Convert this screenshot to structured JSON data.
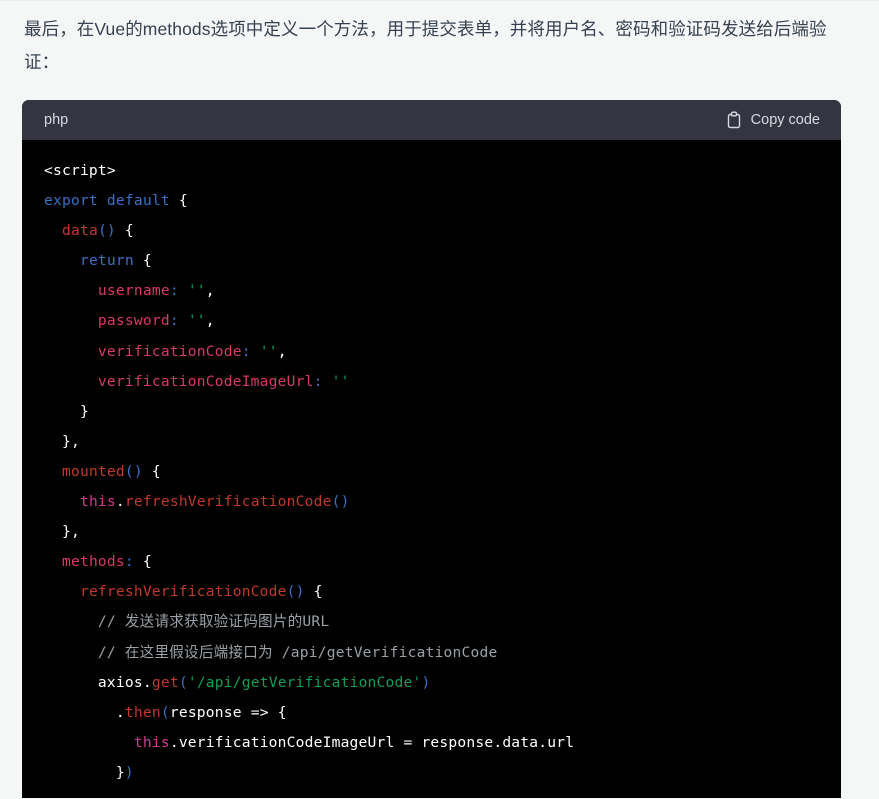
{
  "page": {
    "background_color": "#f5f6f6",
    "text_color": "#374151"
  },
  "paragraph": {
    "text": "最后，在Vue的methods选项中定义一个方法，用于提交表单，并将用户名、密码和验证码发送给后端验证："
  },
  "code_block": {
    "language_label": "php",
    "copy_label": "Copy code",
    "copy_icon": "clipboard-icon",
    "header_bg": "#343541",
    "body_bg": "#000000",
    "code_text": "<script>\nexport default {\n  data() {\n    return {\n      username: '',\n      password: '',\n      verificationCode: '',\n      verificationCodeImageUrl: ''\n    }\n  },\n  mounted() {\n    this.refreshVerificationCode()\n  },\n  methods: {\n    refreshVerificationCode() {\n      // 发送请求获取验证码图片的URL\n      // 在这里假设后端接口为 /api/getVerificationCode\n      axios.get('/api/getVerificationCode')\n        .then(response => {\n          this.verificationCodeImageUrl = response.data.url\n        })",
    "lines": [
      "<script>",
      "export default {",
      "  data() {",
      "    return {",
      "      username: '',",
      "      password: '',",
      "      verificationCode: '',",
      "      verificationCodeImageUrl: ''",
      "    }",
      "  },",
      "  mounted() {",
      "    this.refreshVerificationCode()",
      "  },",
      "  methods: {",
      "    refreshVerificationCode() {",
      "      // 发送请求获取验证码图片的URL",
      "      // 在这里假设后端接口为 /api/getVerificationCode",
      "      axios.get('/api/getVerificationCode')",
      "        .then(response => {",
      "          this.verificationCodeImageUrl = response.data.url",
      "        })"
    ],
    "token_colors": {
      "keyword": "#3d6fc4",
      "function": "#c0392b",
      "property": "#d63a67",
      "string": "#0f9d58",
      "this": "#d13b8c",
      "comment": "#9aa0a6",
      "plain": "#ffffff"
    }
  }
}
